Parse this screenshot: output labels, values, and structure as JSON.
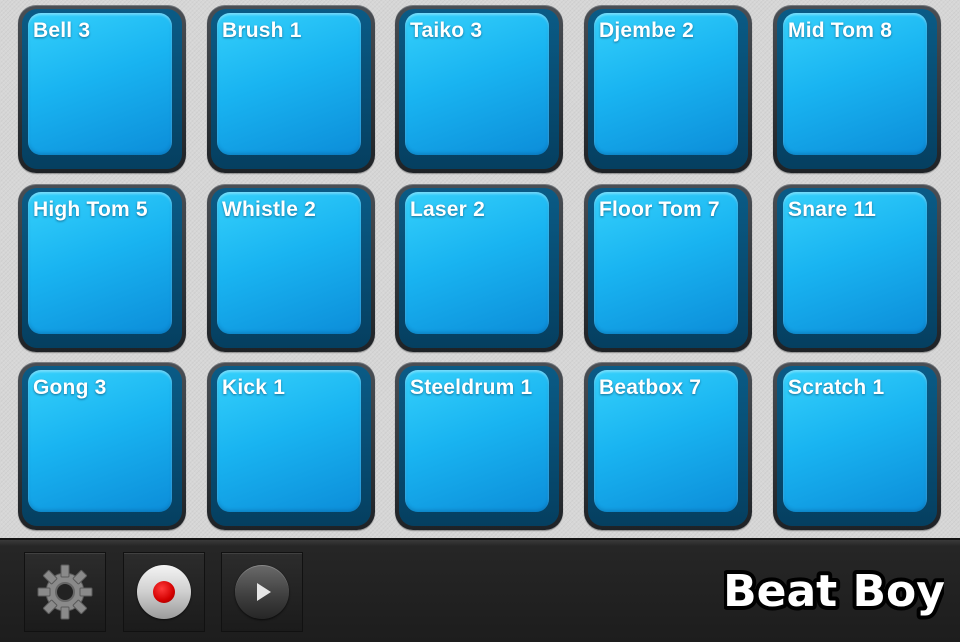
{
  "pads": [
    {
      "label": "Bell 3"
    },
    {
      "label": "Brush 1"
    },
    {
      "label": "Taiko 3"
    },
    {
      "label": "Djembe 2"
    },
    {
      "label": "Mid Tom 8"
    },
    {
      "label": "High Tom 5"
    },
    {
      "label": "Whistle 2"
    },
    {
      "label": "Laser 2"
    },
    {
      "label": "Floor Tom 7"
    },
    {
      "label": "Snare 11"
    },
    {
      "label": "Gong 3"
    },
    {
      "label": "Kick 1"
    },
    {
      "label": "Steeldrum 1"
    },
    {
      "label": "Beatbox 7"
    },
    {
      "label": "Scratch 1"
    }
  ],
  "toolbar": {
    "settings_icon": "gear-icon",
    "record_icon": "record-icon",
    "play_icon": "play-icon"
  },
  "logo": {
    "text": "Beat Boy"
  },
  "colors": {
    "pad_blue": "#1bb6f2",
    "record_red": "#d30000",
    "toolbar_dark": "#1d1d1d"
  }
}
